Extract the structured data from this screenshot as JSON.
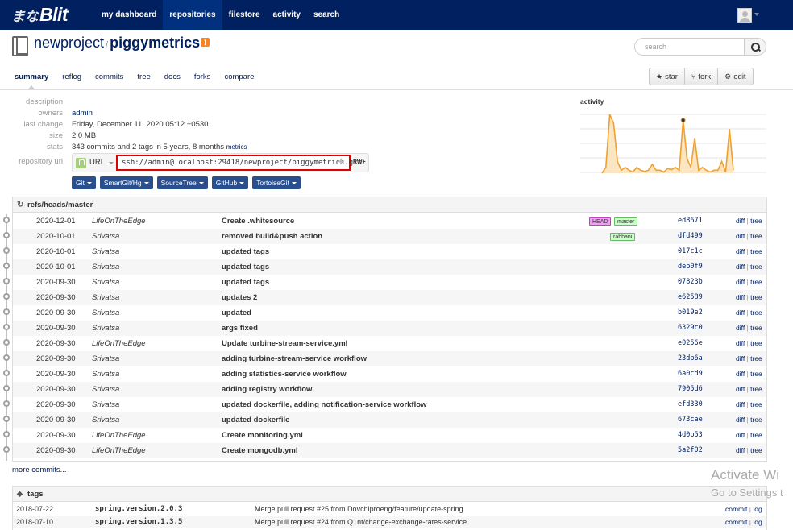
{
  "app": {
    "logo_mark": "まな",
    "logo_text": "Blit"
  },
  "nav": {
    "links": [
      "my dashboard",
      "repositories",
      "filestore",
      "activity",
      "search"
    ],
    "active": "repositories"
  },
  "repo": {
    "project": "newproject",
    "separator": "/",
    "name": "piggymetrics"
  },
  "search": {
    "placeholder": "search"
  },
  "subnav": {
    "items": [
      "summary",
      "reflog",
      "commits",
      "tree",
      "docs",
      "forks",
      "compare"
    ],
    "active": "summary"
  },
  "actions": {
    "star": "star",
    "fork": "fork",
    "edit": "edit"
  },
  "meta": {
    "description_label": "description",
    "description_value": "",
    "owners_label": "owners",
    "owners_value": "admin",
    "last_change_label": "last change",
    "last_change_value": "Friday, December 11, 2020 05:12 +0530",
    "size_label": "size",
    "size_value": "2.0 MB",
    "stats_label": "stats",
    "stats_value": "343 commits and 2 tags in 5 years, 8 months",
    "metrics_link": "metrics",
    "repo_url_label": "repository url",
    "url_protocol": "URL",
    "url_value": "ssh://admin@localhost:29418/newproject/piggymetrics.git",
    "url_permission": "RW+"
  },
  "clients": [
    "Git",
    "SmartGit/Hg",
    "SourceTree",
    "GitHub",
    "TortoiseGit"
  ],
  "activity": {
    "title": "activity",
    "accent": "#f0a030",
    "values": [
      0,
      0.1,
      1,
      0.85,
      0.2,
      0.05,
      0.1,
      0.05,
      0.02,
      0.1,
      0.05,
      0.03,
      0.05,
      0.15,
      0.05,
      0.05,
      0.02,
      0.08,
      0.06,
      0.1,
      0.05,
      0.9,
      0.25,
      0.1,
      0.6,
      0.05,
      0.1,
      0.05,
      0.02,
      0.05,
      0.05,
      0.2,
      0.02,
      0.75,
      0.05
    ]
  },
  "commits": {
    "ref": "refs/heads/master",
    "diff_label": "diff",
    "tree_label": "tree",
    "rows": [
      {
        "date": "2020-12-01",
        "author": "LifeOnTheEdge",
        "msg": "Create .whitesource",
        "badges": [
          {
            "text": "HEAD",
            "kind": "head"
          },
          {
            "text": "master",
            "kind": "branch"
          }
        ],
        "sha": "ed8671"
      },
      {
        "date": "2020-10-01",
        "author": "Srivatsa",
        "msg": "removed build&push action",
        "badges": [
          {
            "text": "rabbani",
            "kind": "branch"
          }
        ],
        "sha": "dfd499"
      },
      {
        "date": "2020-10-01",
        "author": "Srivatsa",
        "msg": "updated tags",
        "badges": [],
        "sha": "017c1c"
      },
      {
        "date": "2020-10-01",
        "author": "Srivatsa",
        "msg": "updated tags",
        "badges": [],
        "sha": "deb0f9"
      },
      {
        "date": "2020-09-30",
        "author": "Srivatsa",
        "msg": "updated tags",
        "badges": [],
        "sha": "07823b"
      },
      {
        "date": "2020-09-30",
        "author": "Srivatsa",
        "msg": "updates 2",
        "badges": [],
        "sha": "e62589"
      },
      {
        "date": "2020-09-30",
        "author": "Srivatsa",
        "msg": "updated",
        "badges": [],
        "sha": "b019e2"
      },
      {
        "date": "2020-09-30",
        "author": "Srivatsa",
        "msg": "args fixed",
        "badges": [],
        "sha": "6329c0"
      },
      {
        "date": "2020-09-30",
        "author": "LifeOnTheEdge",
        "msg": "Update turbine-stream-service.yml",
        "badges": [],
        "sha": "e0256e"
      },
      {
        "date": "2020-09-30",
        "author": "Srivatsa",
        "msg": "adding turbine-stream-service workflow",
        "badges": [],
        "sha": "23db6a"
      },
      {
        "date": "2020-09-30",
        "author": "Srivatsa",
        "msg": "adding statistics-service workflow",
        "badges": [],
        "sha": "6a0cd9"
      },
      {
        "date": "2020-09-30",
        "author": "Srivatsa",
        "msg": "adding registry workflow",
        "badges": [],
        "sha": "7905d6"
      },
      {
        "date": "2020-09-30",
        "author": "Srivatsa",
        "msg": "updated dockerfile, adding notification-service workflow",
        "badges": [],
        "sha": "efd330"
      },
      {
        "date": "2020-09-30",
        "author": "Srivatsa",
        "msg": "updated dockerfile",
        "badges": [],
        "sha": "673cae"
      },
      {
        "date": "2020-09-30",
        "author": "LifeOnTheEdge",
        "msg": "Create monitoring.yml",
        "badges": [],
        "sha": "4d0b53"
      },
      {
        "date": "2020-09-30",
        "author": "LifeOnTheEdge",
        "msg": "Create mongodb.yml",
        "badges": [],
        "sha": "5a2f02"
      }
    ],
    "more": "more commits..."
  },
  "tags": {
    "title": "tags",
    "commit_label": "commit",
    "log_label": "log",
    "rows": [
      {
        "date": "2018-07-22",
        "name": "spring.version.2.0.3",
        "msg": "Merge pull request #25 from Dovchiproeng/feature/update-spring"
      },
      {
        "date": "2018-07-10",
        "name": "spring.version.1.3.5",
        "msg": "Merge pull request #24 from Q1nt/change-exchange-rates-service"
      }
    ]
  },
  "watermark": {
    "line1": "Activate Wi",
    "line2": "Go to Settings t"
  }
}
